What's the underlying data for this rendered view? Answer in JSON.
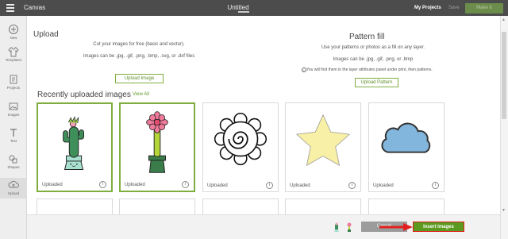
{
  "topbar": {
    "app_title": "Canvas",
    "doc_title": "Untitled",
    "my_projects": "My Projects",
    "save": "Save",
    "make_it": "Make It"
  },
  "sidebar": {
    "items": [
      {
        "label": "New",
        "icon": "plus-icon"
      },
      {
        "label": "Templates",
        "icon": "shirt-icon"
      },
      {
        "label": "Projects",
        "icon": "projects-icon"
      },
      {
        "label": "Images",
        "icon": "images-icon"
      },
      {
        "label": "Text",
        "icon": "text-icon"
      },
      {
        "label": "Shapes",
        "icon": "shapes-icon"
      },
      {
        "label": "Upload",
        "icon": "upload-icon"
      }
    ],
    "active": "Upload"
  },
  "upload_pane": {
    "title": "Upload",
    "line1": "Cut your images for free (basic and vector).",
    "line2": "Images can be .jpg, .gif, .png, .bmp, .svg, or .dxf files",
    "button": "Upload Image"
  },
  "pattern_pane": {
    "title": "Pattern fill",
    "line1": "Use your patterns or photos as a fill on any layer.",
    "line2": "Images can be .jpg, .gif, .png, or .bmp",
    "note": "You will find them in the layer attributes panel under print, then patterns.",
    "button": "Upload Pattern"
  },
  "recent": {
    "title": "Recently uploaded images",
    "view_all": "View All",
    "cards": [
      {
        "label": "Uploaded",
        "image": "cactus-image",
        "selected": true
      },
      {
        "label": "Uploaded",
        "image": "flower-cactus-image",
        "selected": true
      },
      {
        "label": "Uploaded",
        "image": "mandala-flower-image",
        "selected": false
      },
      {
        "label": "Uploaded",
        "image": "star-image",
        "selected": false
      },
      {
        "label": "Uploaded",
        "image": "cloud-image",
        "selected": false
      }
    ]
  },
  "bottom": {
    "cancel": "Cancel",
    "insert": "Insert Images"
  },
  "colors": {
    "accent_green": "#5b9a1f",
    "topbar": "#4c4c4c",
    "arrow_red": "#e02020"
  }
}
